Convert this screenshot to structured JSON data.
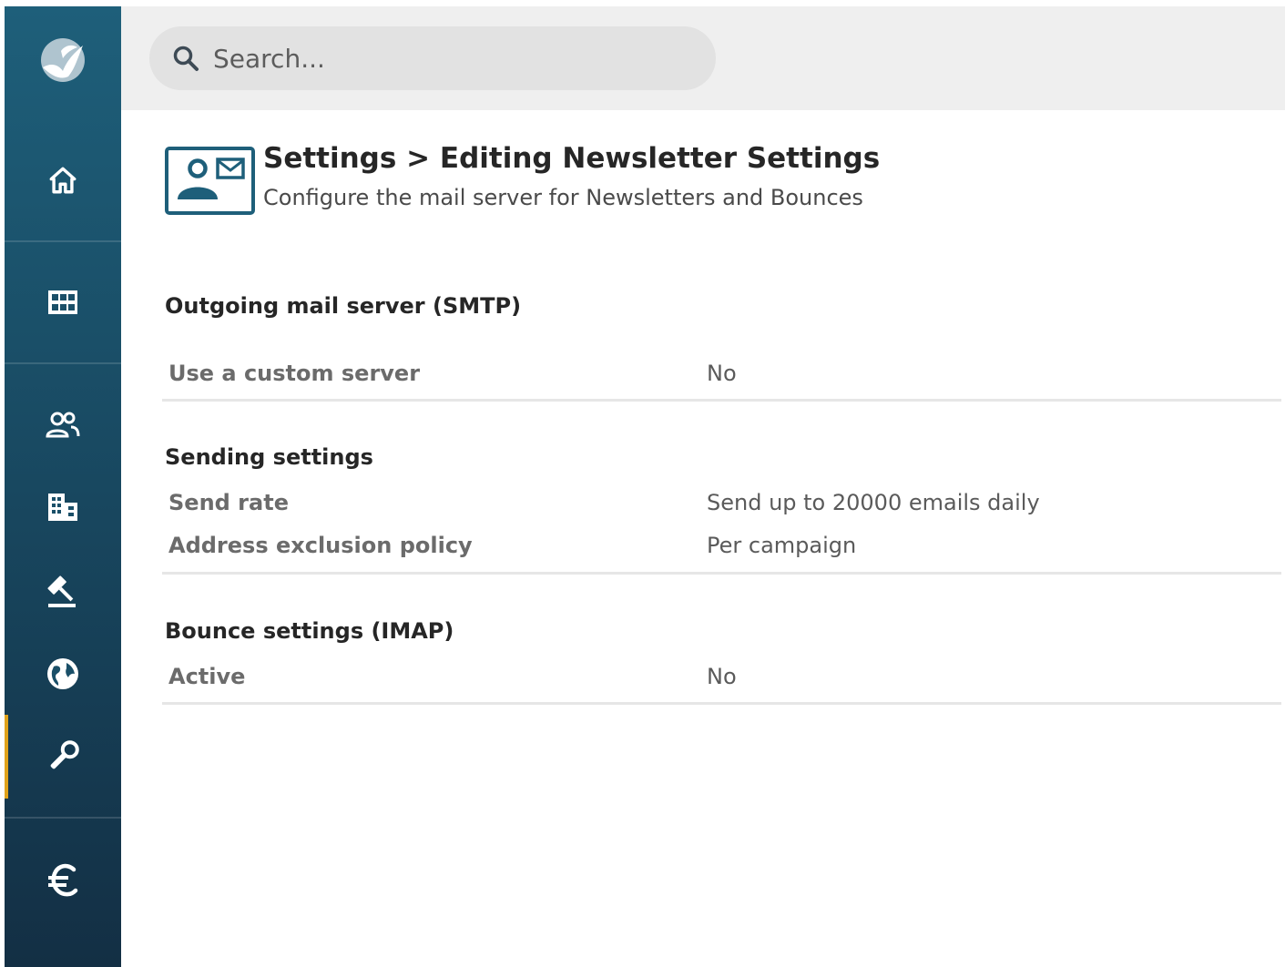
{
  "search": {
    "placeholder": "Search..."
  },
  "sidebar": {
    "items": [
      {
        "icon": "home-icon"
      },
      {
        "icon": "grid-icon"
      },
      {
        "icon": "contacts-icon"
      },
      {
        "icon": "building-icon"
      },
      {
        "icon": "gavel-icon"
      },
      {
        "icon": "globe-icon"
      },
      {
        "icon": "wrench-icon",
        "active": true
      },
      {
        "icon": "euro-icon"
      }
    ],
    "accent_color": "#e0a21a"
  },
  "header": {
    "title": "Settings > Editing Newsletter Settings",
    "subtitle": "Configure the mail server for Newsletters and Bounces",
    "icon": "contact-card-icon"
  },
  "sections": [
    {
      "title": "Outgoing mail server (SMTP)",
      "rows": [
        {
          "label": "Use a custom server",
          "value": "No"
        }
      ]
    },
    {
      "title": "Sending settings",
      "rows": [
        {
          "label": "Send rate",
          "value": "Send up to 20000 emails daily"
        },
        {
          "label": "Address exclusion policy",
          "value": "Per campaign"
        }
      ]
    },
    {
      "title": "Bounce settings (IMAP)",
      "rows": [
        {
          "label": "Active",
          "value": "No"
        }
      ]
    }
  ]
}
